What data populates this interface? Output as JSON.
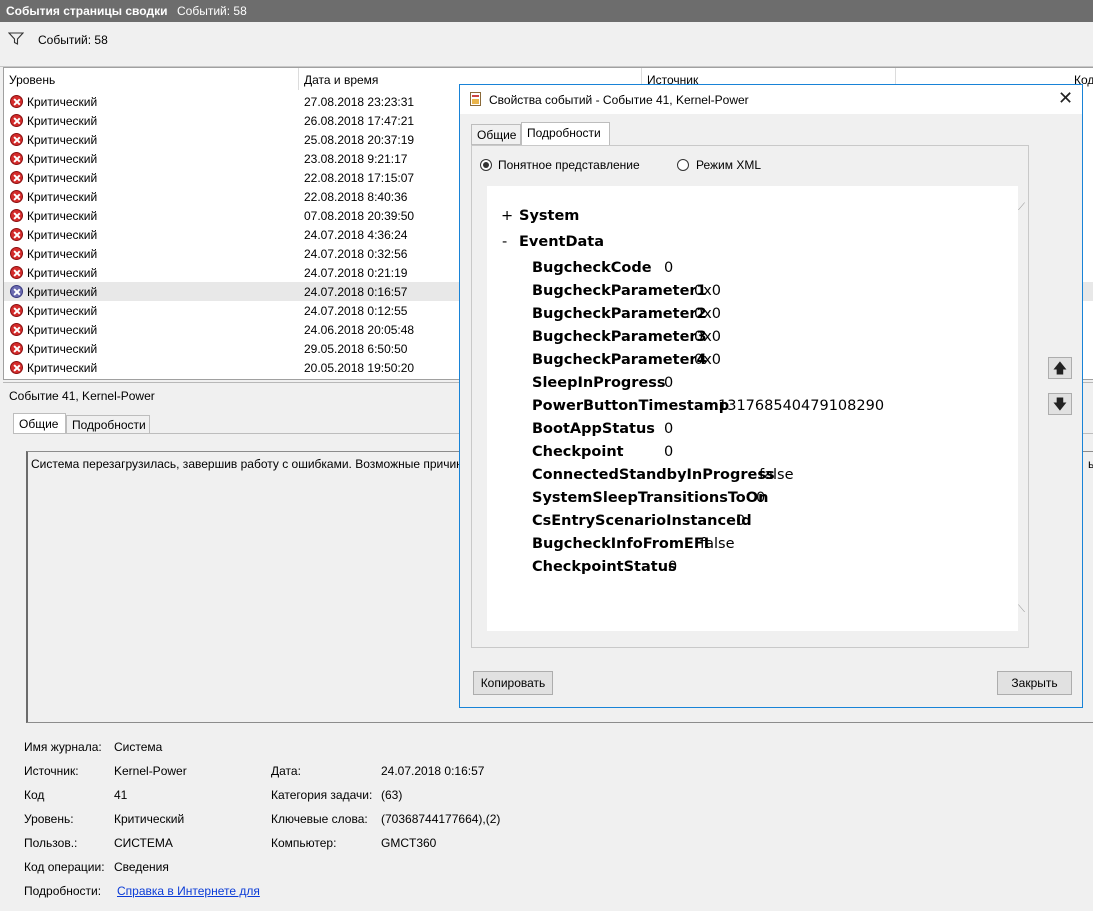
{
  "window": {
    "title": "События страницы сводки",
    "count": "Событий: 58"
  },
  "filter": {
    "count": "Событий: 58"
  },
  "grid": {
    "headers": [
      "Уровень",
      "Дата и время",
      "Источник",
      "Код"
    ],
    "rows": [
      {
        "level": "Критический",
        "date": "27.08.2018 23:23:31"
      },
      {
        "level": "Критический",
        "date": "26.08.2018 17:47:21"
      },
      {
        "level": "Критический",
        "date": "25.08.2018 20:37:19"
      },
      {
        "level": "Критический",
        "date": "23.08.2018 9:21:17"
      },
      {
        "level": "Критический",
        "date": "22.08.2018 17:15:07"
      },
      {
        "level": "Критический",
        "date": "22.08.2018 8:40:36"
      },
      {
        "level": "Критический",
        "date": "07.08.2018 20:39:50"
      },
      {
        "level": "Критический",
        "date": "24.07.2018 4:36:24"
      },
      {
        "level": "Критический",
        "date": "24.07.2018 0:32:56"
      },
      {
        "level": "Критический",
        "date": "24.07.2018 0:21:19"
      },
      {
        "level": "Критический",
        "date": "24.07.2018 0:16:57"
      },
      {
        "level": "Критический",
        "date": "24.07.2018 0:12:55"
      },
      {
        "level": "Критический",
        "date": "24.06.2018 20:05:48"
      },
      {
        "level": "Критический",
        "date": "29.05.2018 6:50:50"
      },
      {
        "level": "Критический",
        "date": "20.05.2018 19:50:20"
      }
    ]
  },
  "detail": {
    "header": "Событие 41, Kernel-Power",
    "tabs": [
      "Общие",
      "Подробности"
    ],
    "description": "Система перезагрузилась, завершив работу с ошибками. Возможные причин",
    "description_tail": "ь",
    "fields": {
      "log_label": "Имя журнала:",
      "log_value": "Система",
      "source_label": "Источник:",
      "source_value": "Kernel-Power",
      "date_label": "Дата:",
      "date_value": "24.07.2018 0:16:57",
      "code_label": "Код",
      "code_value": "41",
      "task_label": "Категория задачи:",
      "task_value": "(63)",
      "level_label": "Уровень:",
      "level_value": "Критический",
      "keywords_label": "Ключевые слова:",
      "keywords_value": "(70368744177664),(2)",
      "user_label": "Пользов.:",
      "user_value": "СИСТЕМА",
      "computer_label": "Компьютер:",
      "computer_value": "GMCT360",
      "opcode_label": "Код операции:",
      "opcode_value": "Сведения",
      "more_label": "Подробности:",
      "more_link": "Справка в Интернете для"
    }
  },
  "dialog": {
    "title": "Свойства событий - Событие 41, Kernel-Power",
    "close_glyph": "✕",
    "tabs": [
      "Общие",
      "Подробности"
    ],
    "radio_friendly": "Понятное представление",
    "radio_xml": "Режим XML",
    "tree": {
      "system_toggle": "+",
      "system_label": "System",
      "eventdata_toggle": "-",
      "eventdata_label": "EventData",
      "fields": [
        {
          "key": "BugcheckCode",
          "value": "0"
        },
        {
          "key": "BugcheckParameter1",
          "value": "0x0"
        },
        {
          "key": "BugcheckParameter2",
          "value": "0x0"
        },
        {
          "key": "BugcheckParameter3",
          "value": "0x0"
        },
        {
          "key": "BugcheckParameter4",
          "value": "0x0"
        },
        {
          "key": "SleepInProgress",
          "value": "0"
        },
        {
          "key": "PowerButtonTimestamp",
          "value": "131768540479108290"
        },
        {
          "key": "BootAppStatus",
          "value": "0"
        },
        {
          "key": "Checkpoint",
          "value": "0"
        },
        {
          "key": "ConnectedStandbyInProgress",
          "value": "false"
        },
        {
          "key": "SystemSleepTransitionsToOn",
          "value": "0"
        },
        {
          "key": "CsEntryScenarioInstanceId",
          "value": "0"
        },
        {
          "key": "BugcheckInfoFromEFI",
          "value": "false"
        },
        {
          "key": "CheckpointStatus",
          "value": "0"
        }
      ]
    },
    "copy_button": "Копировать",
    "close_button": "Закрыть",
    "up_glyph": "🡅",
    "down_glyph": "🡇"
  }
}
